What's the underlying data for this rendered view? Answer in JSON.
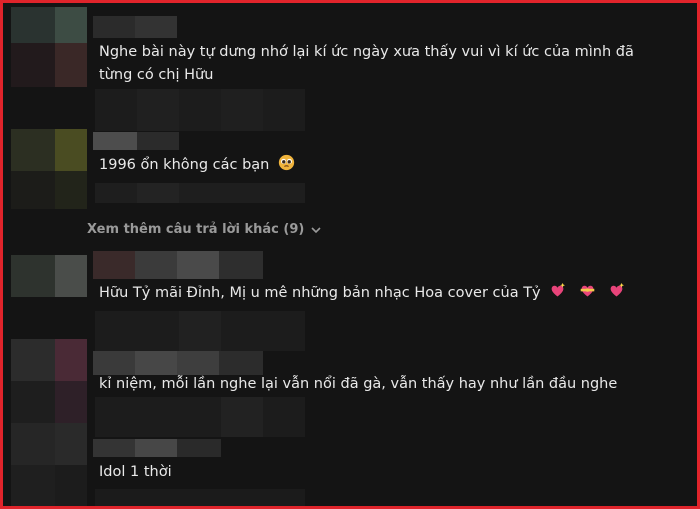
{
  "comments": [
    {
      "text_line1": "Nghe bài này tự dưng nhớ lại kí ức ngày xưa thấy vui vì kí ức của mình đã",
      "text_line2": "từng có chị Hữu"
    },
    {
      "text": "1996 ổn không các bạn",
      "emoji": "pleading-face"
    },
    {
      "text": "Hữu Tỷ mãi Đỉnh, Mị u mê những bản nhạc Hoa cover của Tỷ",
      "emojis": [
        "sparkling-heart",
        "heart-with-ribbon",
        "sparkling-heart"
      ]
    },
    {
      "text": "kỉ niệm, mỗi lần nghe lại vẫn nổi đã gà, vẫn thấy hay như lần đầu nghe"
    },
    {
      "text": "Idol 1 thời"
    }
  ],
  "more_replies": {
    "label": "Xem thêm câu trả lời khác (9)",
    "icon": "chevron-down-icon"
  },
  "colors": {
    "background": "#141414",
    "text": "#e9e9e9",
    "muted": "#9a9a9a",
    "border": "#e0242b"
  }
}
